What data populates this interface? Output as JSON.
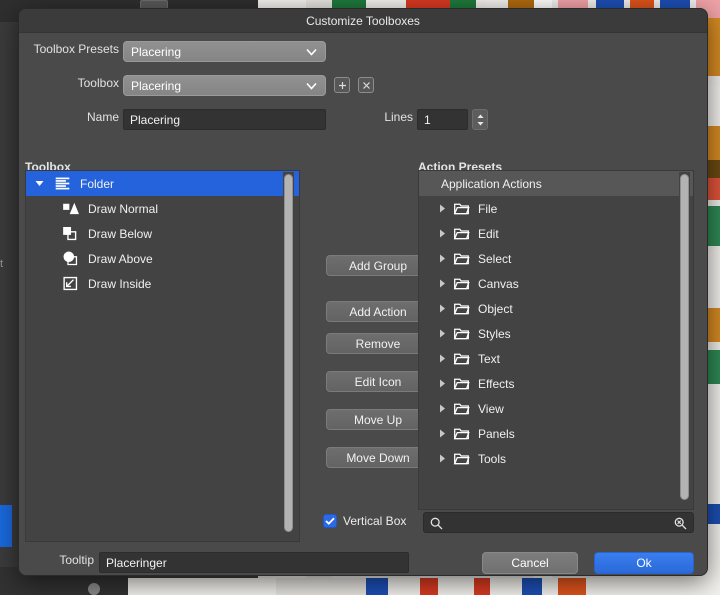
{
  "dialog": {
    "title": "Customize Toolboxes"
  },
  "form": {
    "presets_label": "Toolbox Presets",
    "presets_value": "Placering",
    "toolbox_label": "Toolbox",
    "toolbox_value": "Placering",
    "add_toolbox_icon": "plus-icon",
    "delete_toolbox_icon": "close-icon",
    "name_label": "Name",
    "name_value": "Placering",
    "lines_label": "Lines",
    "lines_value": "1"
  },
  "toolbox_panel": {
    "title": "Toolbox",
    "items": [
      {
        "label": "Folder",
        "icon": "lines-folder-icon",
        "depth": 0,
        "selected": true,
        "expanded": true
      },
      {
        "label": "Draw Normal",
        "icon": "draw-normal-icon",
        "depth": 1,
        "selected": false,
        "expanded": false
      },
      {
        "label": "Draw Below",
        "icon": "draw-below-icon",
        "depth": 1,
        "selected": false,
        "expanded": false
      },
      {
        "label": "Draw Above",
        "icon": "draw-above-icon",
        "depth": 1,
        "selected": false,
        "expanded": false
      },
      {
        "label": "Draw Inside",
        "icon": "draw-inside-icon",
        "depth": 1,
        "selected": false,
        "expanded": false
      }
    ]
  },
  "actions_panel": {
    "title": "Action Presets",
    "header_row": "Application Actions",
    "items": [
      {
        "label": "File",
        "icon": "folder-icon"
      },
      {
        "label": "Edit",
        "icon": "folder-icon"
      },
      {
        "label": "Select",
        "icon": "folder-icon"
      },
      {
        "label": "Canvas",
        "icon": "folder-icon"
      },
      {
        "label": "Object",
        "icon": "folder-icon"
      },
      {
        "label": "Styles",
        "icon": "folder-icon"
      },
      {
        "label": "Text",
        "icon": "folder-icon"
      },
      {
        "label": "Effects",
        "icon": "folder-icon"
      },
      {
        "label": "View",
        "icon": "folder-icon"
      },
      {
        "label": "Panels",
        "icon": "folder-icon"
      },
      {
        "label": "Tools",
        "icon": "folder-icon"
      }
    ]
  },
  "center_buttons": [
    {
      "label": "Add Group"
    },
    {
      "label": "Add Action"
    },
    {
      "label": "Remove"
    },
    {
      "label": "Edit Icon"
    },
    {
      "label": "Move Up"
    },
    {
      "label": "Move Down"
    }
  ],
  "footer": {
    "vertical_box_label": "Vertical Box",
    "vertical_box_checked": true,
    "search_value": "",
    "search_placeholder": "",
    "search_icon": "search-icon",
    "search_clear_icon": "search-clear-icon",
    "tooltip_label": "Tooltip",
    "tooltip_value": "Placeringer",
    "cancel_label": "Cancel",
    "ok_label": "Ok"
  },
  "colors": {
    "accent": "#2563dd",
    "ok_button": "#2a6ad8",
    "dialog_body": "#4a4a4a",
    "titlebar": "#3b3b3b",
    "panel": "#434343",
    "field": "#333333",
    "combo": "#8b8b8b"
  }
}
